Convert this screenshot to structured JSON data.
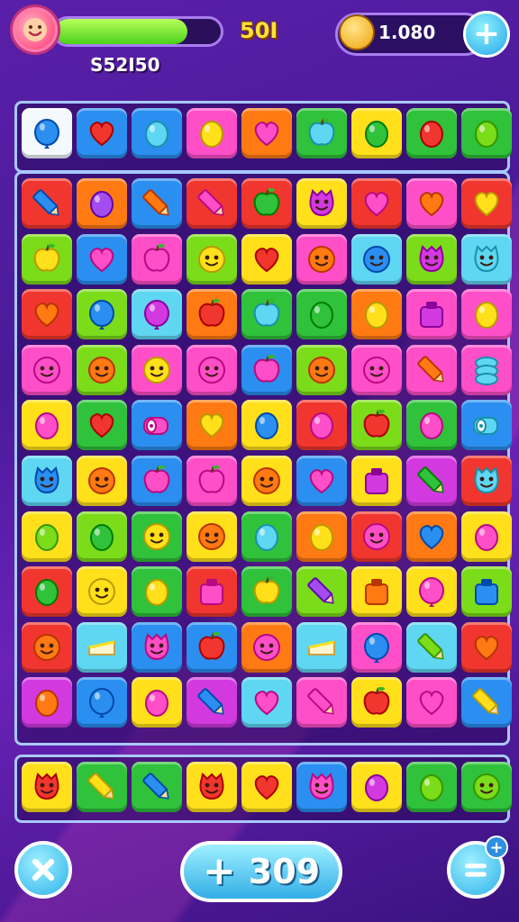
{
  "hud": {
    "level": "50I",
    "score": "S52I50",
    "progress": 0.8,
    "coins": "1.080",
    "add_coins_icon": "plus-icon"
  },
  "colors": {
    "red": "#f0362e",
    "orange": "#ff7a12",
    "yellow": "#ffe01a",
    "lime": "#7bdc1a",
    "green": "#2fc23a",
    "cyan": "#5fd6f2",
    "blue": "#2a8ff0",
    "pink": "#ff4fc8",
    "magenta": "#d23ae0",
    "purple": "#a44cf0"
  },
  "top_row": [
    {
      "bg": "white",
      "icon": "balloon",
      "fg": "blue"
    },
    {
      "bg": "blue",
      "icon": "heart",
      "fg": "red"
    },
    {
      "bg": "blue",
      "icon": "drop",
      "fg": "cyan"
    },
    {
      "bg": "pink",
      "icon": "drop",
      "fg": "yellow"
    },
    {
      "bg": "orange",
      "icon": "heart",
      "fg": "pink"
    },
    {
      "bg": "green",
      "icon": "apple",
      "fg": "cyan"
    },
    {
      "bg": "yellow",
      "icon": "drop",
      "fg": "green"
    },
    {
      "bg": "green",
      "icon": "drop",
      "fg": "red"
    },
    {
      "bg": "green",
      "icon": "drop",
      "fg": "lime"
    }
  ],
  "grid": [
    [
      {
        "bg": "red",
        "icon": "pencil",
        "fg": "blue"
      },
      {
        "bg": "orange",
        "icon": "drop",
        "fg": "purple"
      },
      {
        "bg": "blue",
        "icon": "pencil",
        "fg": "orange"
      },
      {
        "bg": "red",
        "icon": "pencil",
        "fg": "pink"
      },
      {
        "bg": "red",
        "icon": "apple",
        "fg": "green"
      },
      {
        "bg": "yellow",
        "icon": "monster",
        "fg": "magenta"
      },
      {
        "bg": "red",
        "icon": "heart",
        "fg": "pink"
      },
      {
        "bg": "pink",
        "icon": "heart",
        "fg": "orange"
      },
      {
        "bg": "red",
        "icon": "heart",
        "fg": "yellow"
      }
    ],
    [
      {
        "bg": "lime",
        "icon": "apple",
        "fg": "yellow"
      },
      {
        "bg": "blue",
        "icon": "heart",
        "fg": "pink"
      },
      {
        "bg": "pink",
        "icon": "apple",
        "fg": "pink"
      },
      {
        "bg": "lime",
        "icon": "face",
        "fg": "yellow"
      },
      {
        "bg": "yellow",
        "icon": "heart",
        "fg": "red"
      },
      {
        "bg": "pink",
        "icon": "face",
        "fg": "orange"
      },
      {
        "bg": "cyan",
        "icon": "face",
        "fg": "blue"
      },
      {
        "bg": "lime",
        "icon": "monster",
        "fg": "magenta"
      },
      {
        "bg": "cyan",
        "icon": "monster",
        "fg": "cyan"
      }
    ],
    [
      {
        "bg": "red",
        "icon": "heart",
        "fg": "orange"
      },
      {
        "bg": "lime",
        "icon": "balloon",
        "fg": "blue"
      },
      {
        "bg": "cyan",
        "icon": "balloon",
        "fg": "magenta"
      },
      {
        "bg": "orange",
        "icon": "apple",
        "fg": "red"
      },
      {
        "bg": "green",
        "icon": "apple",
        "fg": "cyan"
      },
      {
        "bg": "green",
        "icon": "drop",
        "fg": "green"
      },
      {
        "bg": "orange",
        "icon": "drop",
        "fg": "yellow"
      },
      {
        "bg": "pink",
        "icon": "box",
        "fg": "magenta"
      },
      {
        "bg": "pink",
        "icon": "drop",
        "fg": "yellow"
      }
    ],
    [
      {
        "bg": "pink",
        "icon": "face",
        "fg": "pink"
      },
      {
        "bg": "lime",
        "icon": "face",
        "fg": "orange"
      },
      {
        "bg": "pink",
        "icon": "face",
        "fg": "yellow"
      },
      {
        "bg": "pink",
        "icon": "face",
        "fg": "pink"
      },
      {
        "bg": "blue",
        "icon": "apple",
        "fg": "pink"
      },
      {
        "bg": "lime",
        "icon": "face",
        "fg": "orange"
      },
      {
        "bg": "pink",
        "icon": "face",
        "fg": "pink"
      },
      {
        "bg": "pink",
        "icon": "pencil",
        "fg": "orange"
      },
      {
        "bg": "pink",
        "icon": "stack",
        "fg": "cyan"
      }
    ],
    [
      {
        "bg": "yellow",
        "icon": "drop",
        "fg": "pink"
      },
      {
        "bg": "green",
        "icon": "heart",
        "fg": "red"
      },
      {
        "bg": "blue",
        "icon": "roll",
        "fg": "pink"
      },
      {
        "bg": "orange",
        "icon": "heart",
        "fg": "yellow"
      },
      {
        "bg": "yellow",
        "icon": "drop",
        "fg": "blue"
      },
      {
        "bg": "red",
        "icon": "drop",
        "fg": "pink"
      },
      {
        "bg": "lime",
        "icon": "apple",
        "fg": "red"
      },
      {
        "bg": "green",
        "icon": "drop",
        "fg": "pink"
      },
      {
        "bg": "blue",
        "icon": "roll",
        "fg": "cyan"
      }
    ],
    [
      {
        "bg": "cyan",
        "icon": "monster",
        "fg": "blue"
      },
      {
        "bg": "yellow",
        "icon": "face",
        "fg": "orange"
      },
      {
        "bg": "blue",
        "icon": "apple",
        "fg": "pink"
      },
      {
        "bg": "pink",
        "icon": "apple",
        "fg": "pink"
      },
      {
        "bg": "yellow",
        "icon": "face",
        "fg": "orange"
      },
      {
        "bg": "blue",
        "icon": "heart",
        "fg": "pink"
      },
      {
        "bg": "yellow",
        "icon": "box",
        "fg": "magenta"
      },
      {
        "bg": "magenta",
        "icon": "pencil",
        "fg": "green"
      },
      {
        "bg": "red",
        "icon": "monster",
        "fg": "cyan"
      }
    ],
    [
      {
        "bg": "yellow",
        "icon": "drop",
        "fg": "lime"
      },
      {
        "bg": "lime",
        "icon": "drop",
        "fg": "green"
      },
      {
        "bg": "green",
        "icon": "face",
        "fg": "yellow"
      },
      {
        "bg": "yellow",
        "icon": "face",
        "fg": "orange"
      },
      {
        "bg": "green",
        "icon": "drop",
        "fg": "cyan"
      },
      {
        "bg": "orange",
        "icon": "drop",
        "fg": "yellow"
      },
      {
        "bg": "red",
        "icon": "face",
        "fg": "pink"
      },
      {
        "bg": "orange",
        "icon": "heart",
        "fg": "blue"
      },
      {
        "bg": "yellow",
        "icon": "drop",
        "fg": "pink"
      }
    ],
    [
      {
        "bg": "red",
        "icon": "drop",
        "fg": "green"
      },
      {
        "bg": "yellow",
        "icon": "face",
        "fg": "yellow"
      },
      {
        "bg": "green",
        "icon": "drop",
        "fg": "yellow"
      },
      {
        "bg": "red",
        "icon": "box",
        "fg": "pink"
      },
      {
        "bg": "green",
        "icon": "apple",
        "fg": "yellow"
      },
      {
        "bg": "lime",
        "icon": "pencil",
        "fg": "purple"
      },
      {
        "bg": "yellow",
        "icon": "box",
        "fg": "orange"
      },
      {
        "bg": "yellow",
        "icon": "balloon",
        "fg": "pink"
      },
      {
        "bg": "lime",
        "icon": "box",
        "fg": "blue"
      }
    ],
    [
      {
        "bg": "red",
        "icon": "face",
        "fg": "orange"
      },
      {
        "bg": "cyan",
        "icon": "cake",
        "fg": "yellow"
      },
      {
        "bg": "blue",
        "icon": "monster",
        "fg": "pink"
      },
      {
        "bg": "blue",
        "icon": "apple",
        "fg": "red"
      },
      {
        "bg": "orange",
        "icon": "face",
        "fg": "pink"
      },
      {
        "bg": "cyan",
        "icon": "cake",
        "fg": "yellow"
      },
      {
        "bg": "pink",
        "icon": "balloon",
        "fg": "blue"
      },
      {
        "bg": "cyan",
        "icon": "pencil",
        "fg": "lime"
      },
      {
        "bg": "red",
        "icon": "heart",
        "fg": "orange"
      }
    ],
    [
      {
        "bg": "magenta",
        "icon": "drop",
        "fg": "orange"
      },
      {
        "bg": "blue",
        "icon": "balloon",
        "fg": "blue"
      },
      {
        "bg": "yellow",
        "icon": "drop",
        "fg": "pink"
      },
      {
        "bg": "magenta",
        "icon": "pencil",
        "fg": "blue"
      },
      {
        "bg": "cyan",
        "icon": "heart",
        "fg": "pink"
      },
      {
        "bg": "pink",
        "icon": "pencil",
        "fg": "pink"
      },
      {
        "bg": "yellow",
        "icon": "apple",
        "fg": "red"
      },
      {
        "bg": "pink",
        "icon": "heart",
        "fg": "pink"
      },
      {
        "bg": "blue",
        "icon": "pencil",
        "fg": "yellow"
      }
    ]
  ],
  "bottom_row": [
    {
      "bg": "yellow",
      "icon": "monster",
      "fg": "red"
    },
    {
      "bg": "green",
      "icon": "pencil",
      "fg": "yellow"
    },
    {
      "bg": "green",
      "icon": "pencil",
      "fg": "blue"
    },
    {
      "bg": "yellow",
      "icon": "monster",
      "fg": "red"
    },
    {
      "bg": "yellow",
      "icon": "heart",
      "fg": "red"
    },
    {
      "bg": "blue",
      "icon": "monster",
      "fg": "pink"
    },
    {
      "bg": "yellow",
      "icon": "drop",
      "fg": "magenta"
    },
    {
      "bg": "green",
      "icon": "drop",
      "fg": "lime"
    },
    {
      "bg": "green",
      "icon": "face",
      "fg": "lime"
    }
  ],
  "controls": {
    "close_icon": "close-icon",
    "moves_plus": "+",
    "moves_value": "309",
    "menu_icon": "menu-icon",
    "menu_badge": "+"
  }
}
